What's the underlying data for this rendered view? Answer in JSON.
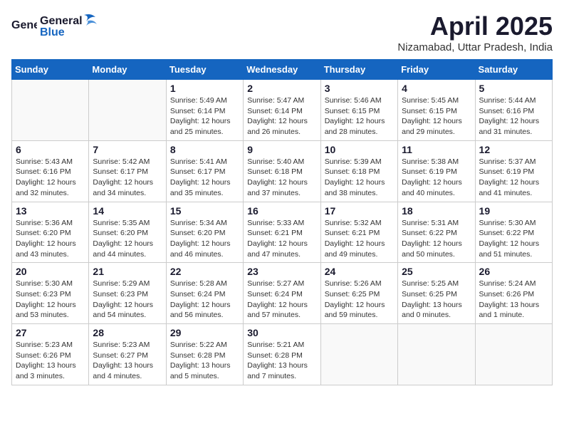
{
  "header": {
    "logo_general": "General",
    "logo_blue": "Blue",
    "month_title": "April 2025",
    "location": "Nizamabad, Uttar Pradesh, India"
  },
  "days_of_week": [
    "Sunday",
    "Monday",
    "Tuesday",
    "Wednesday",
    "Thursday",
    "Friday",
    "Saturday"
  ],
  "weeks": [
    [
      {
        "day": "",
        "info": ""
      },
      {
        "day": "",
        "info": ""
      },
      {
        "day": "1",
        "info": "Sunrise: 5:49 AM\nSunset: 6:14 PM\nDaylight: 12 hours and 25 minutes."
      },
      {
        "day": "2",
        "info": "Sunrise: 5:47 AM\nSunset: 6:14 PM\nDaylight: 12 hours and 26 minutes."
      },
      {
        "day": "3",
        "info": "Sunrise: 5:46 AM\nSunset: 6:15 PM\nDaylight: 12 hours and 28 minutes."
      },
      {
        "day": "4",
        "info": "Sunrise: 5:45 AM\nSunset: 6:15 PM\nDaylight: 12 hours and 29 minutes."
      },
      {
        "day": "5",
        "info": "Sunrise: 5:44 AM\nSunset: 6:16 PM\nDaylight: 12 hours and 31 minutes."
      }
    ],
    [
      {
        "day": "6",
        "info": "Sunrise: 5:43 AM\nSunset: 6:16 PM\nDaylight: 12 hours and 32 minutes."
      },
      {
        "day": "7",
        "info": "Sunrise: 5:42 AM\nSunset: 6:17 PM\nDaylight: 12 hours and 34 minutes."
      },
      {
        "day": "8",
        "info": "Sunrise: 5:41 AM\nSunset: 6:17 PM\nDaylight: 12 hours and 35 minutes."
      },
      {
        "day": "9",
        "info": "Sunrise: 5:40 AM\nSunset: 6:18 PM\nDaylight: 12 hours and 37 minutes."
      },
      {
        "day": "10",
        "info": "Sunrise: 5:39 AM\nSunset: 6:18 PM\nDaylight: 12 hours and 38 minutes."
      },
      {
        "day": "11",
        "info": "Sunrise: 5:38 AM\nSunset: 6:19 PM\nDaylight: 12 hours and 40 minutes."
      },
      {
        "day": "12",
        "info": "Sunrise: 5:37 AM\nSunset: 6:19 PM\nDaylight: 12 hours and 41 minutes."
      }
    ],
    [
      {
        "day": "13",
        "info": "Sunrise: 5:36 AM\nSunset: 6:20 PM\nDaylight: 12 hours and 43 minutes."
      },
      {
        "day": "14",
        "info": "Sunrise: 5:35 AM\nSunset: 6:20 PM\nDaylight: 12 hours and 44 minutes."
      },
      {
        "day": "15",
        "info": "Sunrise: 5:34 AM\nSunset: 6:20 PM\nDaylight: 12 hours and 46 minutes."
      },
      {
        "day": "16",
        "info": "Sunrise: 5:33 AM\nSunset: 6:21 PM\nDaylight: 12 hours and 47 minutes."
      },
      {
        "day": "17",
        "info": "Sunrise: 5:32 AM\nSunset: 6:21 PM\nDaylight: 12 hours and 49 minutes."
      },
      {
        "day": "18",
        "info": "Sunrise: 5:31 AM\nSunset: 6:22 PM\nDaylight: 12 hours and 50 minutes."
      },
      {
        "day": "19",
        "info": "Sunrise: 5:30 AM\nSunset: 6:22 PM\nDaylight: 12 hours and 51 minutes."
      }
    ],
    [
      {
        "day": "20",
        "info": "Sunrise: 5:30 AM\nSunset: 6:23 PM\nDaylight: 12 hours and 53 minutes."
      },
      {
        "day": "21",
        "info": "Sunrise: 5:29 AM\nSunset: 6:23 PM\nDaylight: 12 hours and 54 minutes."
      },
      {
        "day": "22",
        "info": "Sunrise: 5:28 AM\nSunset: 6:24 PM\nDaylight: 12 hours and 56 minutes."
      },
      {
        "day": "23",
        "info": "Sunrise: 5:27 AM\nSunset: 6:24 PM\nDaylight: 12 hours and 57 minutes."
      },
      {
        "day": "24",
        "info": "Sunrise: 5:26 AM\nSunset: 6:25 PM\nDaylight: 12 hours and 59 minutes."
      },
      {
        "day": "25",
        "info": "Sunrise: 5:25 AM\nSunset: 6:25 PM\nDaylight: 13 hours and 0 minutes."
      },
      {
        "day": "26",
        "info": "Sunrise: 5:24 AM\nSunset: 6:26 PM\nDaylight: 13 hours and 1 minute."
      }
    ],
    [
      {
        "day": "27",
        "info": "Sunrise: 5:23 AM\nSunset: 6:26 PM\nDaylight: 13 hours and 3 minutes."
      },
      {
        "day": "28",
        "info": "Sunrise: 5:23 AM\nSunset: 6:27 PM\nDaylight: 13 hours and 4 minutes."
      },
      {
        "day": "29",
        "info": "Sunrise: 5:22 AM\nSunset: 6:28 PM\nDaylight: 13 hours and 5 minutes."
      },
      {
        "day": "30",
        "info": "Sunrise: 5:21 AM\nSunset: 6:28 PM\nDaylight: 13 hours and 7 minutes."
      },
      {
        "day": "",
        "info": ""
      },
      {
        "day": "",
        "info": ""
      },
      {
        "day": "",
        "info": ""
      }
    ]
  ]
}
